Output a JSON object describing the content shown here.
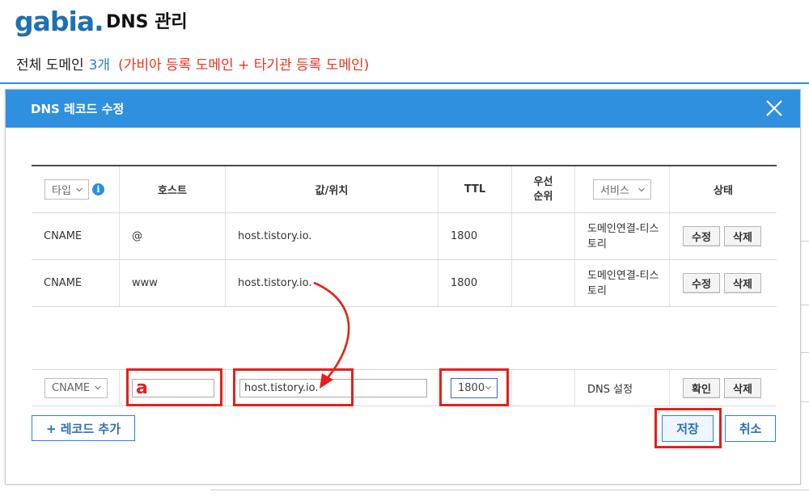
{
  "page": {
    "logo_text": "gabia.",
    "title": "DNS 관리",
    "domain_label": "전체 도메인",
    "domain_count": "3개",
    "domain_note": "(가비아 등록 도메인 + 타기관 등록 도메인)"
  },
  "modal": {
    "title": "DNS 레코드 수정",
    "columns": {
      "type": "타입",
      "host": "호스트",
      "value": "값/위치",
      "ttl": "TTL",
      "priority": "우선 순위",
      "service": "서비스",
      "status": "상태"
    },
    "rows": [
      {
        "type": "CNAME",
        "host": "@",
        "value": "host.tistory.io.",
        "ttl": "1800",
        "priority": "",
        "service": "도메인연결-티스토리",
        "edit_label": "수정",
        "delete_label": "삭제"
      },
      {
        "type": "CNAME",
        "host": "www",
        "value": "host.tistory.io.",
        "ttl": "1800",
        "priority": "",
        "service": "도메인연결-티스토리",
        "edit_label": "수정",
        "delete_label": "삭제"
      }
    ],
    "edit_row": {
      "type": "CNAME",
      "host": "a",
      "value": "host.tistory.io.",
      "ttl": "1800",
      "service": "DNS 설정",
      "confirm_label": "확인",
      "delete_label": "삭제"
    },
    "add_record_label": "+ 레코드 추가",
    "save_label": "저장",
    "cancel_label": "취소"
  },
  "colors": {
    "accent": "#2f90e0",
    "annotation": "#e4201c",
    "note": "#e8341f"
  },
  "icons": [
    "close-icon",
    "info-icon",
    "chevron-down-icon",
    "annotation-arrow"
  ]
}
